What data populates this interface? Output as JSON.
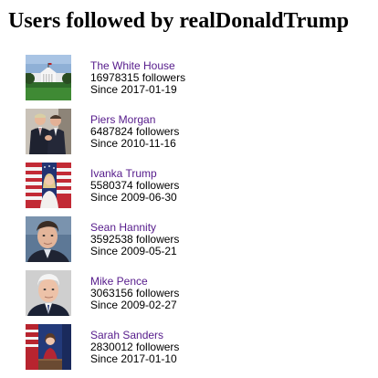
{
  "page": {
    "title": "Users followed by realDonaldTrump"
  },
  "colors": {
    "link": "#551a8b",
    "text": "#000000"
  },
  "users": [
    {
      "name": "The White House",
      "followers": "16978315 followers",
      "since": "Since 2017-01-19",
      "avatar_icon": "white-house-photo"
    },
    {
      "name": "Piers Morgan",
      "followers": "6487824 followers",
      "since": "Since 2010-11-16",
      "avatar_icon": "two-men-handshake-photo"
    },
    {
      "name": "Ivanka Trump",
      "followers": "5580374 followers",
      "since": "Since 2009-06-30",
      "avatar_icon": "woman-with-flags-photo"
    },
    {
      "name": "Sean Hannity",
      "followers": "3592538 followers",
      "since": "Since 2009-05-21",
      "avatar_icon": "man-portrait-photo"
    },
    {
      "name": "Mike Pence",
      "followers": "3063156 followers",
      "since": "Since 2009-02-27",
      "avatar_icon": "white-haired-man-photo"
    },
    {
      "name": "Sarah Sanders",
      "followers": "2830012 followers",
      "since": "Since 2017-01-10",
      "avatar_icon": "woman-at-podium-photo"
    }
  ]
}
